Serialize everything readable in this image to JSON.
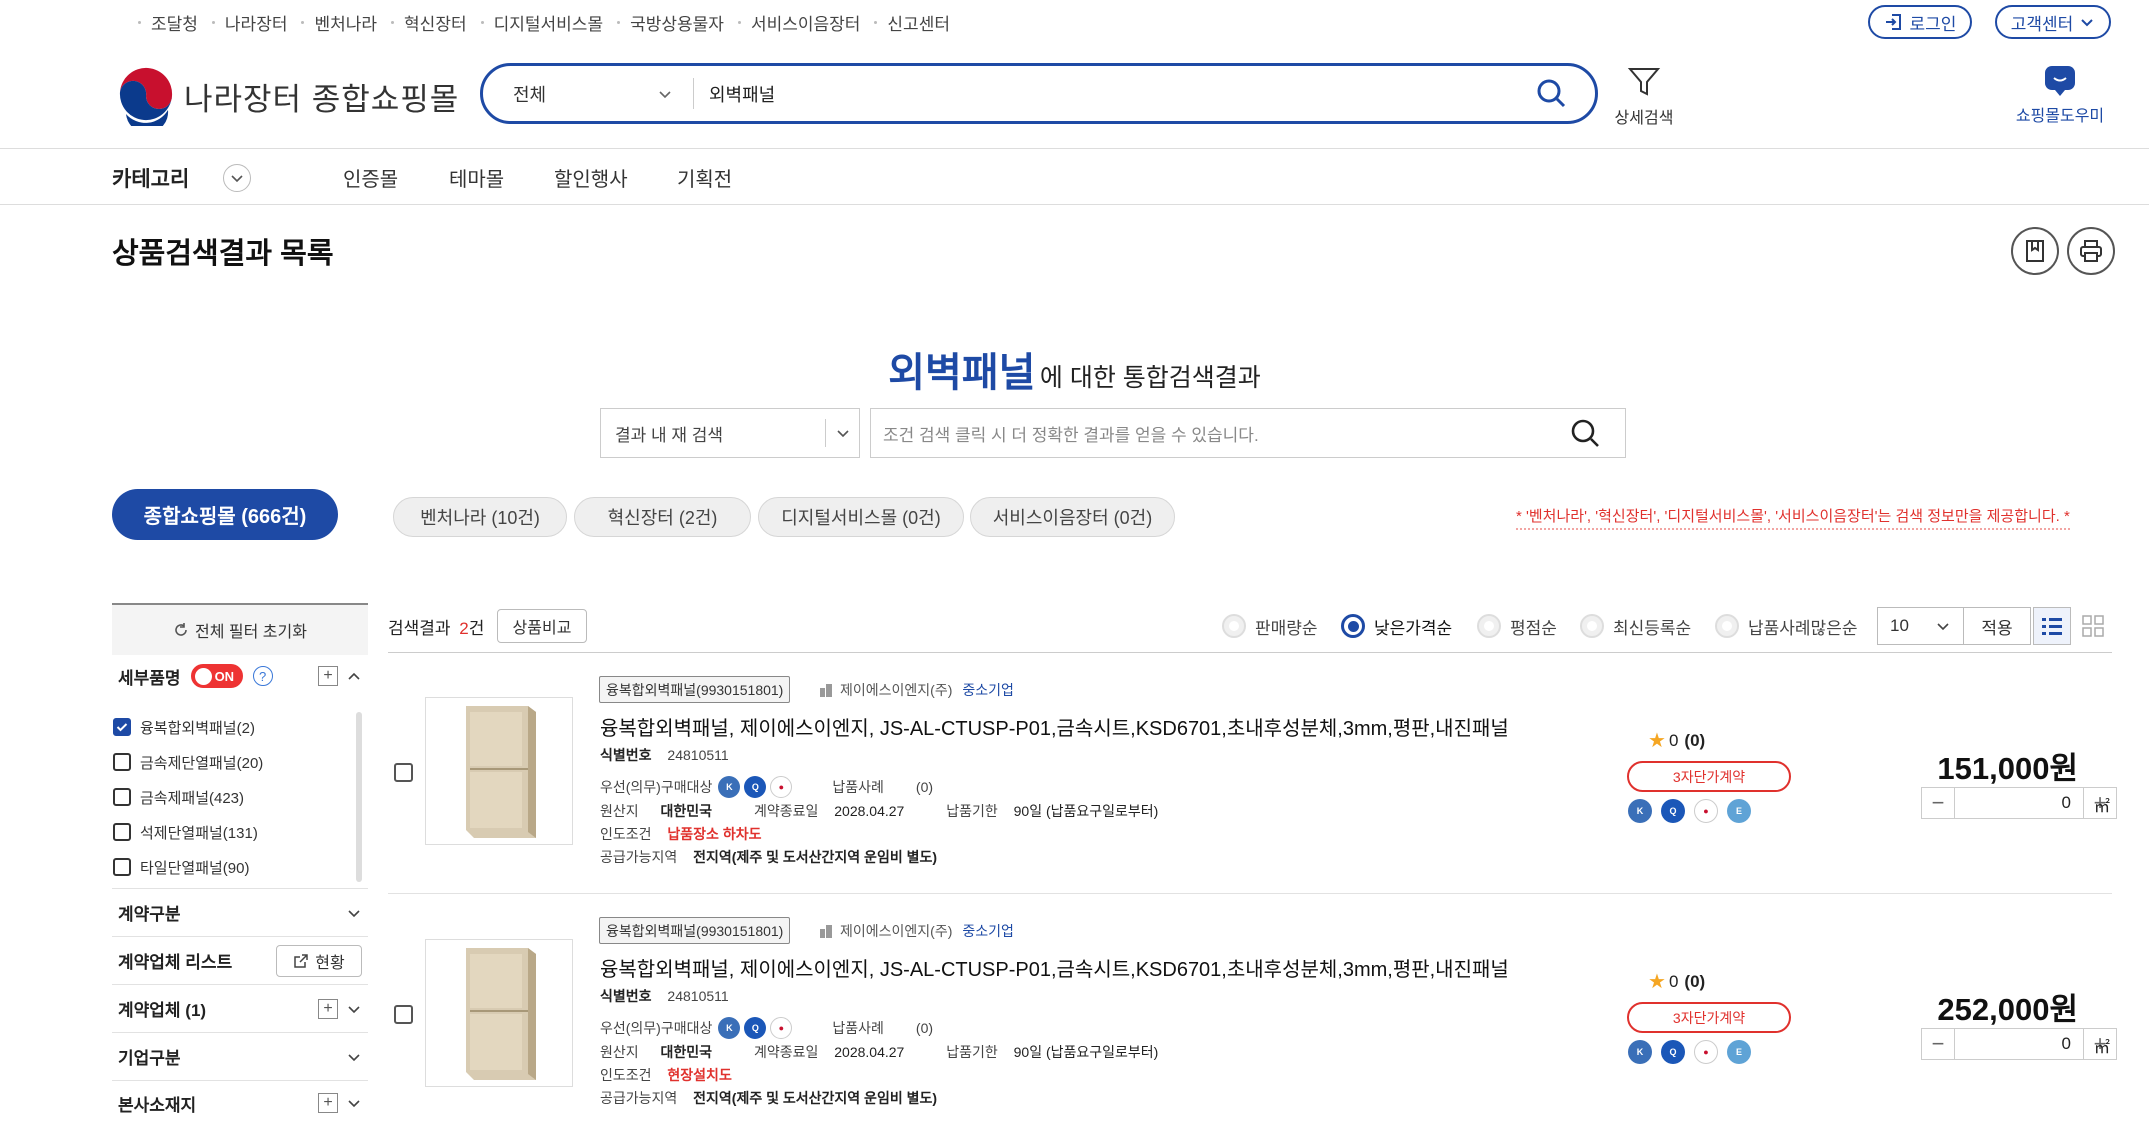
{
  "util_links": [
    "조달청",
    "나라장터",
    "벤처나라",
    "혁신장터",
    "디지털서비스몰",
    "국방상용물자",
    "서비스이음장터",
    "신고센터"
  ],
  "util_buttons": {
    "login": "로그인",
    "support": "고객센터"
  },
  "header": {
    "logo_text": "나라장터 종합쇼핑몰",
    "search_scope": "전체",
    "search_value": "외벽패널",
    "advanced_search": "상세검색",
    "helper": "쇼핑몰도우미"
  },
  "nav": {
    "category": "카테고리",
    "items": [
      "인증몰",
      "테마몰",
      "할인행사",
      "기획전"
    ]
  },
  "page_title": "상품검색결과 목록",
  "result_heading": {
    "keyword": "외벽패널",
    "rest": "에 대한 통합검색결과"
  },
  "inner_search": {
    "scope": "결과 내 재 검색",
    "placeholder": "조건 검색 클릭 시 더 정확한 결과를 얻을 수 있습니다."
  },
  "mall_tabs": [
    "종합쇼핑몰 (666건)",
    "벤처나라 (10건)",
    "혁신장터 (2건)",
    "디지털서비스몰 (0건)",
    "서비스이음장터 (0건)"
  ],
  "notice": "* '벤처나라', '혁신장터', '디지털서비스몰', '서비스이음장터'는 검색 정보만을 제공합니다. *",
  "filters": {
    "reset": "전체 필터 초기화",
    "detail_item_label": "세부품명",
    "toggle": "ON",
    "detail_items": [
      {
        "label": "융복합외벽패널(2)",
        "checked": true
      },
      {
        "label": "금속제단열패널(20)",
        "checked": false
      },
      {
        "label": "금속제패널(423)",
        "checked": false
      },
      {
        "label": "석제단열패널(131)",
        "checked": false
      },
      {
        "label": "타일단열패널(90)",
        "checked": false
      }
    ],
    "contract_type": "계약구분",
    "vendor_list": "계약업체 리스트",
    "status_button": "현황",
    "vendor": "계약업체 (1)",
    "company_type": "기업구분",
    "hq_location": "본사소재지"
  },
  "results_bar": {
    "count_label": "검색결과",
    "count_value": "2",
    "count_unit": "건",
    "compare": "상품비교",
    "sort_options": [
      {
        "label": "판매량순",
        "selected": false
      },
      {
        "label": "낮은가격순",
        "selected": true
      },
      {
        "label": "평점순",
        "selected": false
      },
      {
        "label": "최신등록순",
        "selected": false
      },
      {
        "label": "납품사례많은순",
        "selected": false
      }
    ],
    "page_size": "10",
    "apply": "적용"
  },
  "products": [
    {
      "category_chip": "융복합외벽패널(9930151801)",
      "vendor": "제이에스이엔지(주)",
      "vendor_type": "중소기업",
      "title": "융복합외벽패널, 제이에스이엔지, JS-AL-CTUSP-P01,금속시트,KSD6701,초내후성분체,3mm,평판,내진패널",
      "id_label": "식별번호",
      "id_value": "24810511",
      "priority_label": "우선(의무)구매대상",
      "delivery_case_label": "납품사례",
      "delivery_case_value": "(0)",
      "origin_label": "원산지",
      "origin_value": "대한민국",
      "contract_end_label": "계약종료일",
      "contract_end_value": "2028.04.27",
      "due_label": "납품기한",
      "due_value": "90일 (납품요구일로부터)",
      "terms_label": "인도조건",
      "terms_value": "납품장소 하차도",
      "region_label": "공급가능지역",
      "region_value": "전지역(제주 및 도서산간지역 운임비 별도)",
      "rating": "0",
      "rating_count": "(0)",
      "tier": "3자단가계약",
      "price": "151,000원",
      "qty": "0",
      "unit": "㎡"
    },
    {
      "category_chip": "융복합외벽패널(9930151801)",
      "vendor": "제이에스이엔지(주)",
      "vendor_type": "중소기업",
      "title": "융복합외벽패널, 제이에스이엔지, JS-AL-CTUSP-P01,금속시트,KSD6701,초내후성분체,3mm,평판,내진패널",
      "id_label": "식별번호",
      "id_value": "24810511",
      "priority_label": "우선(의무)구매대상",
      "delivery_case_label": "납품사례",
      "delivery_case_value": "(0)",
      "origin_label": "원산지",
      "origin_value": "대한민국",
      "contract_end_label": "계약종료일",
      "contract_end_value": "2028.04.27",
      "due_label": "납품기한",
      "due_value": "90일 (납품요구일로부터)",
      "terms_label": "인도조건",
      "terms_value": "현장설치도",
      "region_label": "공급가능지역",
      "region_value": "전지역(제주 및 도서산간지역 운임비 별도)",
      "rating": "0",
      "rating_count": "(0)",
      "tier": "3자단가계약",
      "price": "252,000원",
      "qty": "0",
      "unit": "㎡"
    }
  ],
  "colors": {
    "brand": "#1e4aa5",
    "accent_red": "#e0312d"
  }
}
